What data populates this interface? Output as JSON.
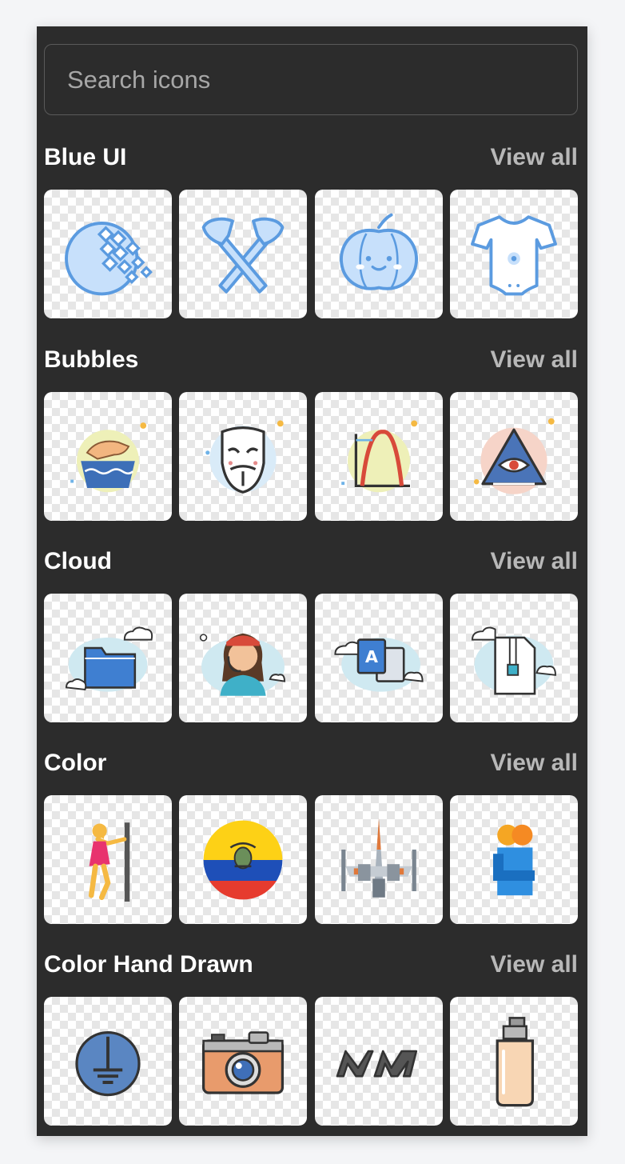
{
  "search": {
    "placeholder": "Search icons"
  },
  "sections": [
    {
      "title": "Blue UI",
      "view_all": "View all",
      "icons": [
        "webmoney-globe-icon",
        "crossed-axes-icon",
        "pumpkin-face-icon",
        "baby-onesie-icon"
      ]
    },
    {
      "title": "Bubbles",
      "view_all": "View all",
      "icons": [
        "hand-wash-icon",
        "anonymous-mask-icon",
        "bell-curve-graph-icon",
        "illuminati-eye-icon"
      ]
    },
    {
      "title": "Cloud",
      "view_all": "View all",
      "icons": [
        "cloud-folder-icon",
        "woman-headset-icon",
        "translate-icon",
        "zip-file-icon"
      ]
    },
    {
      "title": "Color",
      "view_all": "View all",
      "icons": [
        "pole-dancer-icon",
        "ecuador-flag-icon",
        "x-wing-fighter-icon",
        "hug-icon"
      ]
    },
    {
      "title": "Color Hand Drawn",
      "view_all": "View all",
      "icons": [
        "ground-symbol-icon",
        "camera-icon",
        "modern-warfare-logo-icon",
        "pump-bottle-icon"
      ]
    }
  ],
  "colors": {
    "panel_bg": "#2c2c2c",
    "page_bg": "#f4f5f7",
    "title_text": "#ffffff",
    "view_all_text": "#b8b8b8",
    "blue_ui_stroke": "#5b9be0",
    "blue_ui_fill": "#c7e0fb"
  }
}
